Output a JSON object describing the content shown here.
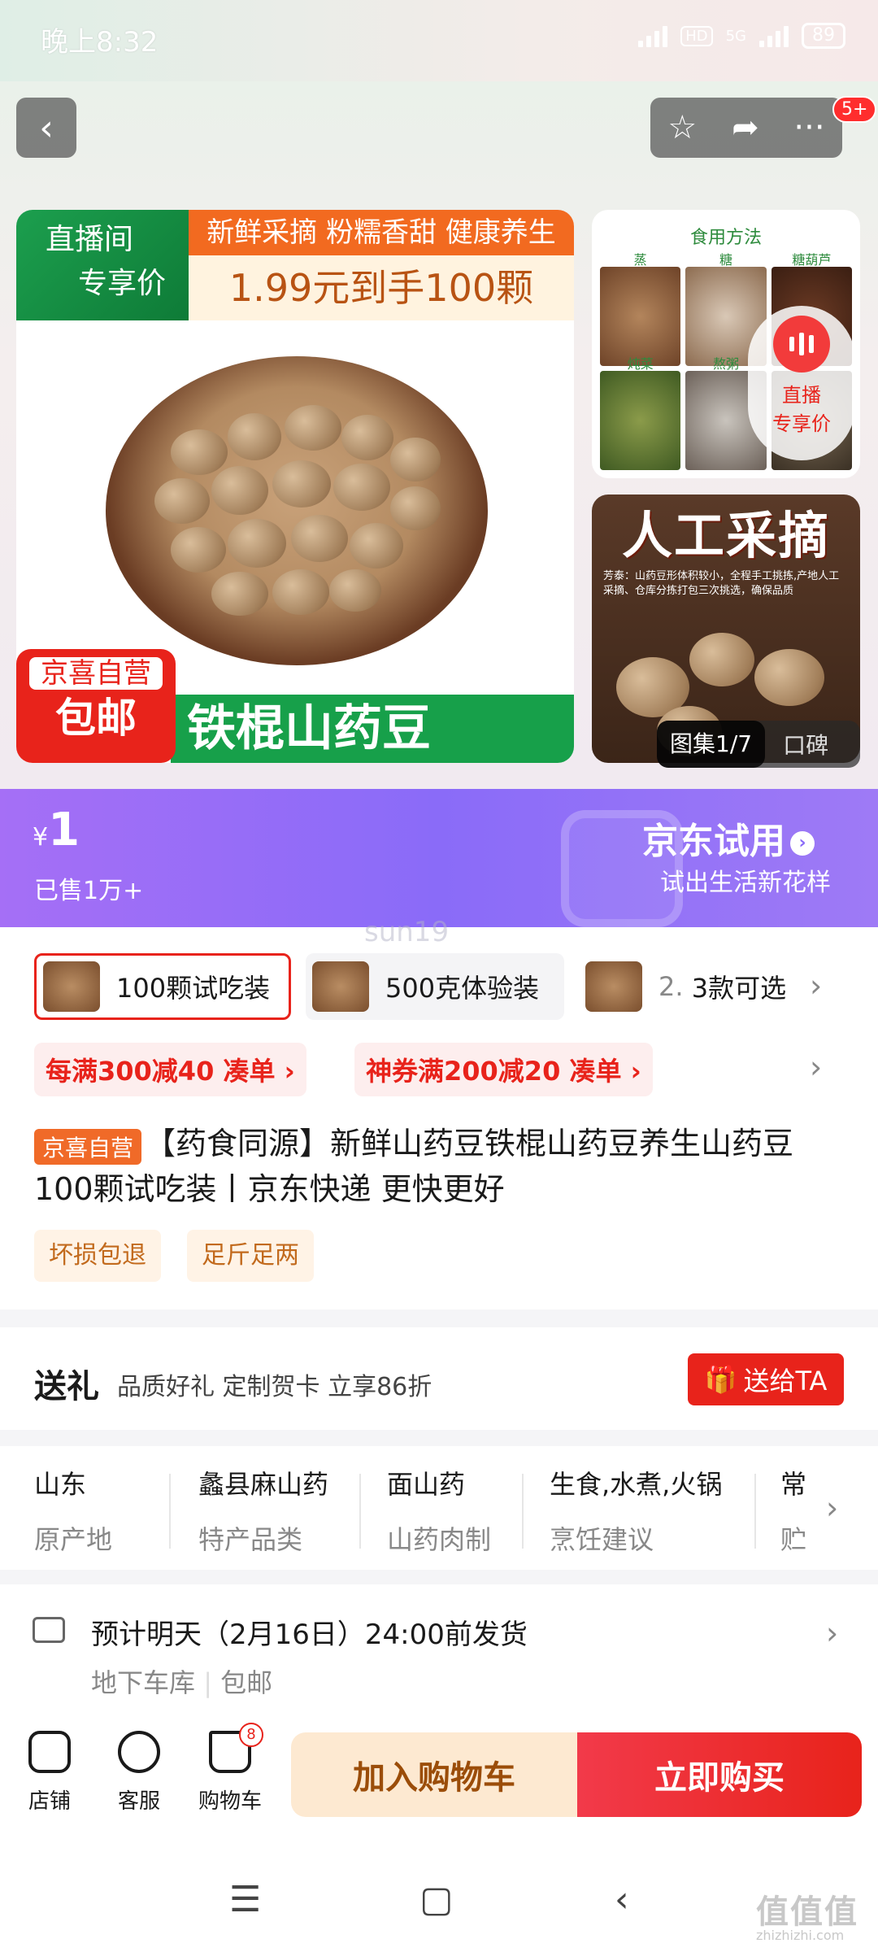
{
  "status": {
    "time": "晚上8:32",
    "net": "5G",
    "hd": "HD",
    "battery": "89"
  },
  "header": {
    "badge": "5+"
  },
  "hero": {
    "live_label_1": "直播间",
    "live_label_2": "专享价",
    "banner_line1": "新鲜采摘 粉糯香甜 健康养生",
    "banner_line2": "1.99元到手100颗",
    "tag_line1": "京喜自营",
    "tag_line2": "包邮",
    "product_name_overlay": "铁棍山药豆",
    "side1_title": "食用方法",
    "side1_items": [
      "蒸",
      "糖",
      "糖葫芦",
      "炖菜",
      "熬粥",
      ""
    ],
    "live_circle_1": "直播",
    "live_circle_2": "专享价",
    "side2_title": "人工采摘",
    "side2_text": "芳泰：山药豆形体积较小，全程手工挑拣,产地人工采摘、仓库分拣打包三次挑选，确保品质",
    "gallery": "图集1/7",
    "reviews": "口碑"
  },
  "price": {
    "currency": "¥",
    "value": "1",
    "sold": "已售1万+",
    "trial_title": "京东试用",
    "trial_sub": "试出生活新花样",
    "watermark": "sun19"
  },
  "skus": [
    {
      "label": "100颗试吃装"
    },
    {
      "label": "500克体验装"
    },
    {
      "label": "2."
    },
    {
      "label": "3款可选"
    }
  ],
  "coupons": [
    "每满300减40 凑单 ›",
    "神券满200减20 凑单 ›"
  ],
  "product": {
    "store_tag": "京喜自营",
    "title": "【药食同源】新鲜山药豆铁棍山药豆养生山药豆 100颗试吃装丨京东快递 更快更好",
    "services": [
      "坏损包退",
      "足斤足两"
    ]
  },
  "gift": {
    "label": "送礼",
    "desc": "品质好礼 定制贺卡 立享86折",
    "button": "送给TA"
  },
  "attributes": [
    {
      "value": "山东",
      "key": "原产地"
    },
    {
      "value": "蠡县麻山药",
      "key": "特产品类"
    },
    {
      "value": "面山药",
      "key": "山药肉制"
    },
    {
      "value": "生食,水煮,火锅",
      "key": "烹饪建议"
    },
    {
      "value": "常",
      "key": "贮"
    }
  ],
  "shipping": {
    "title": "预计明天（2月16日）24:00前发货",
    "sub1": "地下车库",
    "sub2": "包邮"
  },
  "bottom": {
    "store": "店铺",
    "service": "客服",
    "cart": "购物车",
    "cart_count": "8",
    "add_cart": "加入购物车",
    "buy_now": "立即购买"
  },
  "watermark": {
    "main": "值值值",
    "sub": "zhizhizhi.com"
  }
}
